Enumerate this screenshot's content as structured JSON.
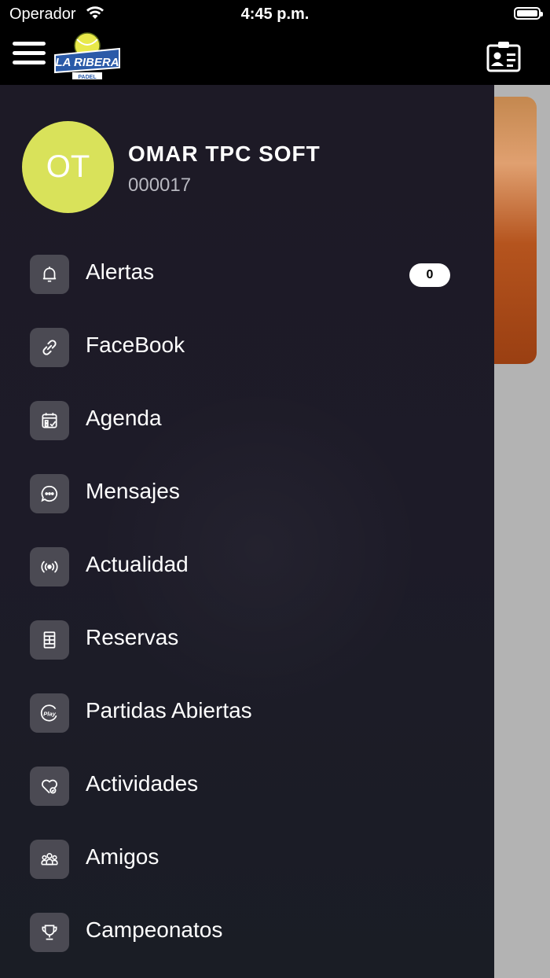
{
  "status_bar": {
    "carrier": "Operador",
    "time": "4:45 p.m."
  },
  "app_bar": {
    "logo_text": "LA RIBERA",
    "logo_subtext": "PADEL"
  },
  "profile": {
    "initials": "OT",
    "name": "OMAR TPC SOFT",
    "member_id": "000017"
  },
  "colors": {
    "avatar": "#d9e25a",
    "drawer": "#1d1a26",
    "icon_tile": "#4b4a53"
  },
  "menu": [
    {
      "label": "Alertas",
      "icon": "bell-icon",
      "badge": "0"
    },
    {
      "label": "FaceBook",
      "icon": "link-icon"
    },
    {
      "label": "Agenda",
      "icon": "calendar-icon"
    },
    {
      "label": "Mensajes",
      "icon": "chat-bubble-icon"
    },
    {
      "label": "Actualidad",
      "icon": "broadcast-icon"
    },
    {
      "label": "Reservas",
      "icon": "court-icon"
    },
    {
      "label": "Partidas Abiertas",
      "icon": "play-icon"
    },
    {
      "label": "Actividades",
      "icon": "heart-check-icon"
    },
    {
      "label": "Amigos",
      "icon": "group-icon"
    },
    {
      "label": "Campeonatos",
      "icon": "trophy-icon"
    }
  ]
}
